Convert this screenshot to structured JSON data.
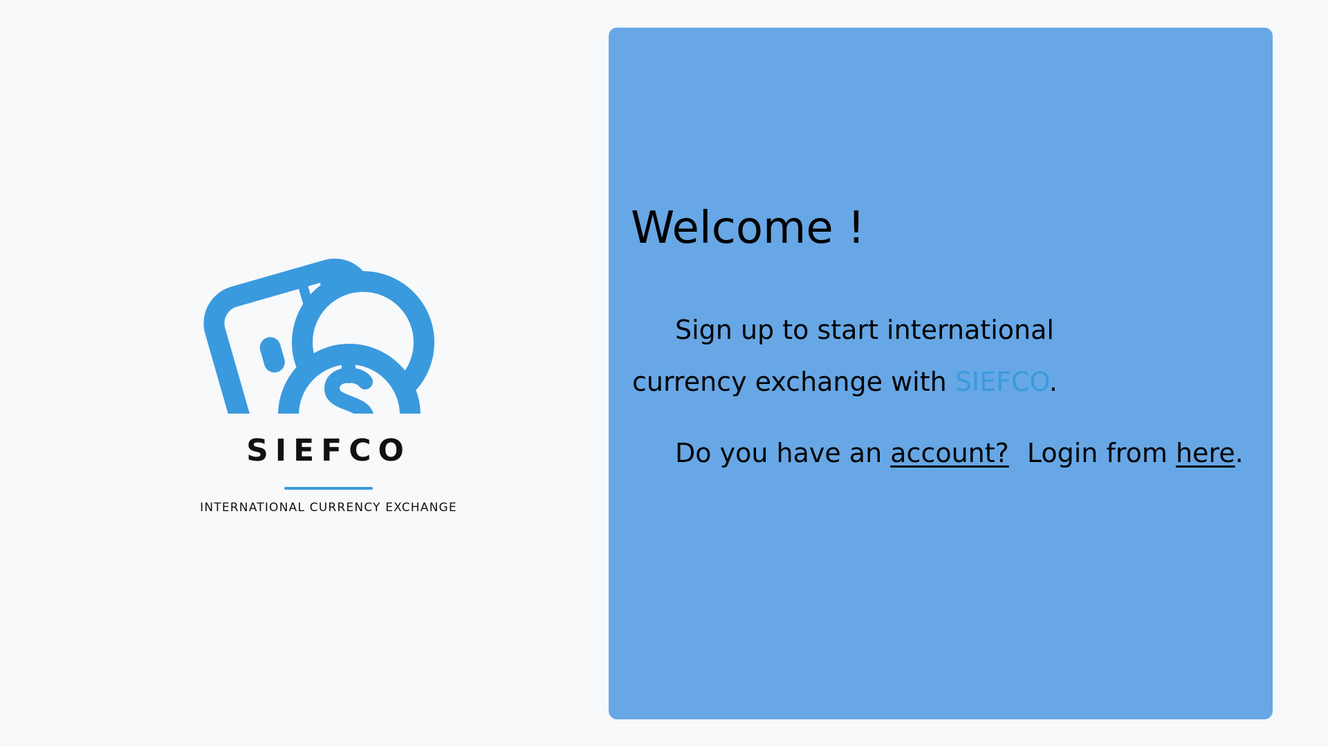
{
  "logo": {
    "name": "SIEFCO",
    "tagline": "INTERNATIONAL CURRENCY EXCHANGE",
    "brand_color": "#3a9ade",
    "icon": "card-and-dollar-coin-icon"
  },
  "welcome": {
    "title": "Welcome !",
    "intro_prefix": "Sign up to start international currency exchange with ",
    "intro_brand": "SIEFCO",
    "intro_suffix": ".",
    "question_prefix": "Do you have an ",
    "account_link": "account?",
    "login_prefix": "Login from ",
    "here_link": "here",
    "login_suffix": "."
  },
  "colors": {
    "background": "#f7f9fb",
    "panel": "#67a7e5",
    "accent": "#3a9ade"
  }
}
